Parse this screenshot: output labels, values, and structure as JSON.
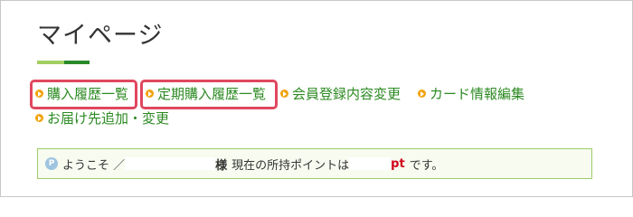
{
  "page_title": "マイページ",
  "nav": {
    "purchase_history": "購入履歴一覧",
    "subscription_history": "定期購入履歴一覧",
    "member_info_edit": "会員登録内容変更",
    "card_info_edit": "カード情報編集",
    "delivery_address": "お届け先追加・変更"
  },
  "welcome": {
    "icon_letter": "P",
    "greeting": "ようこそ ／",
    "honorific": "様",
    "points_text": "現在の所持ポイントは",
    "unit": "pt",
    "suffix": "です。"
  },
  "colors": {
    "link": "#2c8a22",
    "bullet": "#f2a20a",
    "highlight": "#e0475f",
    "welcome_border": "#9ccc6a",
    "points_unit": "#d0021b"
  },
  "icons": [
    "bullet-arrow-icon",
    "point-p-icon"
  ]
}
